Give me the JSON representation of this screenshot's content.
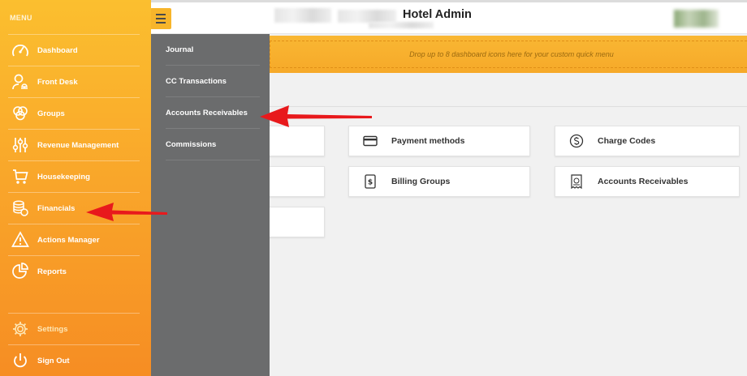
{
  "header": {
    "title": "Hotel Admin"
  },
  "quick_menu": {
    "placeholder": "Drop up to 8 dashboard icons here for your custom quick menu"
  },
  "sidebar": {
    "heading": "MENU",
    "items": [
      {
        "label": "Dashboard",
        "icon": "gauge-icon"
      },
      {
        "label": "Front Desk",
        "icon": "bell-icon"
      },
      {
        "label": "Groups",
        "icon": "groups-icon"
      },
      {
        "label": "Revenue Management",
        "icon": "sliders-icon"
      },
      {
        "label": "Housekeeping",
        "icon": "cart-icon"
      },
      {
        "label": "Financials",
        "icon": "coins-icon"
      },
      {
        "label": "Actions Manager",
        "icon": "alert-icon"
      },
      {
        "label": "Reports",
        "icon": "pie-chart-icon"
      },
      {
        "label": "Settings",
        "icon": "gear-icon"
      },
      {
        "label": "Sign Out",
        "icon": "power-icon"
      }
    ]
  },
  "submenu": {
    "items": [
      {
        "label": "Journal"
      },
      {
        "label": "CC Transactions"
      },
      {
        "label": "Accounts Receivables"
      },
      {
        "label": "Commissions"
      }
    ]
  },
  "cards": [
    {
      "label": "Payment methods",
      "icon": "credit-card-icon"
    },
    {
      "label": "Charge Codes",
      "icon": "dollar-coin-icon"
    },
    {
      "label": "Billing Groups",
      "icon": "invoice-icon"
    },
    {
      "label": "Accounts Receivables",
      "icon": "receipt-icon"
    }
  ],
  "colors": {
    "sidebar_top": "#fbbf2f",
    "sidebar_bottom": "#f68d23",
    "submenu_bg": "#6b6c6d",
    "arrow": "#e8191c"
  }
}
